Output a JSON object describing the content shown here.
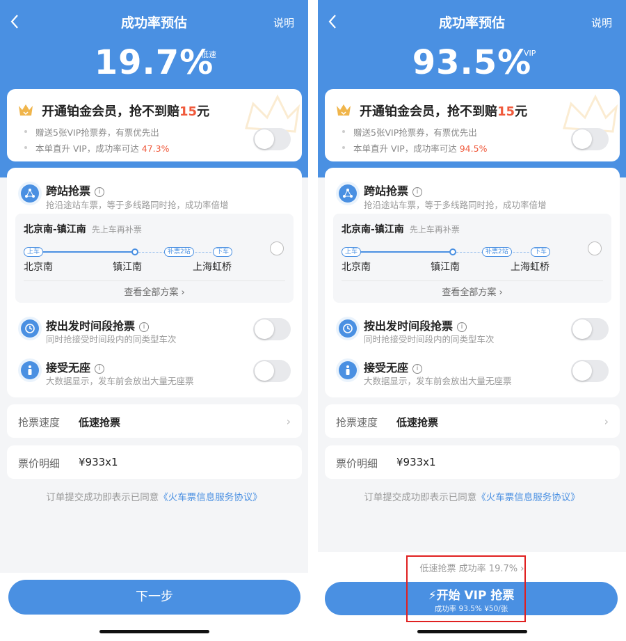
{
  "left": {
    "header": {
      "title": "成功率预估",
      "help": "说明"
    },
    "rate": "19.7%",
    "rate_tag": "低速",
    "vip": {
      "title_prefix": "开通铂金会员，抢不到赔",
      "title_amount": "15",
      "title_suffix": "元",
      "line1": "赠送5张VIP抢票券，有票优先出",
      "line2_prefix": "本单直升 VIP，成功率可达",
      "line2_rate": "47.3%"
    },
    "options": {
      "cross": {
        "title": "跨站抢票",
        "sub": "抢沿途站车票，等于多线路同时抢，成功率倍增"
      },
      "route": {
        "title": "北京南-镇江南",
        "note": "先上车再补票",
        "pill_board": "上车",
        "pill_make": "补票2站",
        "pill_alight": "下车",
        "from": "北京南",
        "mid": "镇江南",
        "to": "上海虹桥",
        "view_all": "查看全部方案"
      },
      "time": {
        "title": "按出发时间段抢票",
        "sub": "同时抢接受时间段内的同类型车次"
      },
      "noseat": {
        "title": "接受无座",
        "sub": "大数据显示，发车前会放出大量无座票"
      }
    },
    "speed": {
      "label": "抢票速度",
      "value": "低速抢票"
    },
    "price": {
      "label": "票价明细",
      "value": "¥933x1"
    },
    "agree": {
      "prefix": "订单提交成功即表示已同意",
      "link": "《火车票信息服务协议》"
    },
    "next_button": "下一步"
  },
  "right": {
    "header": {
      "title": "成功率预估",
      "help": "说明"
    },
    "rate": "93.5%",
    "rate_tag": "VIP",
    "vip": {
      "title_prefix": "开通铂金会员，抢不到赔",
      "title_amount": "15",
      "title_suffix": "元",
      "line1": "赠送5张VIP抢票券，有票优先出",
      "line2_prefix": "本单直升 VIP，成功率可达",
      "line2_rate": "94.5%"
    },
    "options": {
      "cross": {
        "title": "跨站抢票",
        "sub": "抢沿途站车票，等于多线路同时抢，成功率倍增"
      },
      "route": {
        "title": "北京南-镇江南",
        "note": "先上车再补票",
        "pill_board": "上车",
        "pill_make": "补票2站",
        "pill_alight": "下车",
        "from": "北京南",
        "mid": "镇江南",
        "to": "上海虹桥",
        "view_all": "查看全部方案"
      },
      "time": {
        "title": "按出发时间段抢票",
        "sub": "同时抢接受时间段内的同类型车次"
      },
      "noseat": {
        "title": "接受无座",
        "sub": "大数据显示，发车前会放出大量无座票"
      }
    },
    "speed": {
      "label": "抢票速度",
      "value": "低速抢票"
    },
    "price": {
      "label": "票价明细",
      "value": "¥933x1"
    },
    "agree": {
      "prefix": "订单提交成功即表示已同意",
      "link": "《火车票信息服务协议》"
    },
    "low_speed_line": "低速抢票 成功率 19.7%",
    "vip_button": {
      "title": "开始 VIP 抢票",
      "sub": "成功率 93.5% ¥50/张"
    }
  },
  "colors": {
    "primary": "#4a90e2",
    "accent_red": "#f05a3c",
    "highlight_box": "#e02020"
  }
}
